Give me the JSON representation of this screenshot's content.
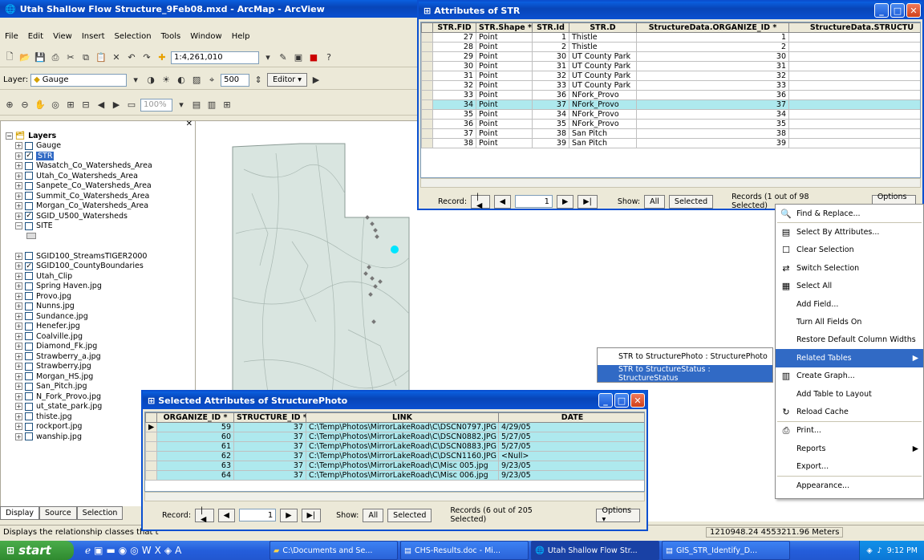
{
  "arcmap": {
    "title": "Utah Shallow Flow Structure_9Feb08.mxd - ArcMap - ArcView",
    "menu": [
      "File",
      "Edit",
      "View",
      "Insert",
      "Selection",
      "Tools",
      "Window",
      "Help"
    ],
    "scale": "1:4,261,010",
    "layer_label": "Layer:",
    "layer_value": "Gauge",
    "snap_value": "500",
    "editor_label": "Editor ▾",
    "zoom_value": "100%",
    "toc_title": "Layers",
    "toc_tabs": [
      "Display",
      "Source",
      "Selection"
    ],
    "status_left": "Displays the relationship classes that t",
    "status_coords": "1210948.24  4553211.96 Meters"
  },
  "toc": [
    {
      "label": "Gauge",
      "checked": false
    },
    {
      "label": "STR",
      "checked": true,
      "selected": true
    },
    {
      "label": "Wasatch_Co_Watersheds_Area",
      "checked": false
    },
    {
      "label": "Utah_Co_Watersheds_Area",
      "checked": false
    },
    {
      "label": "Sanpete_Co_Watersheds_Area",
      "checked": false
    },
    {
      "label": "Summit_Co_Watersheds_Area",
      "checked": false
    },
    {
      "label": "Morgan_Co_Watersheds_Area",
      "checked": false
    },
    {
      "label": "SGID_U500_Watersheds",
      "checked": true
    },
    {
      "label": "SITE",
      "checked": false,
      "expanded": true
    },
    {
      "label": "SGID100_StreamsTIGER2000",
      "checked": false
    },
    {
      "label": "SGID100_CountyBoundaries",
      "checked": true
    },
    {
      "label": "Utah_Clip",
      "checked": false
    },
    {
      "label": "Spring Haven.jpg",
      "checked": false
    },
    {
      "label": "Provo.jpg",
      "checked": false
    },
    {
      "label": "Nunns.jpg",
      "checked": false
    },
    {
      "label": "Sundance.jpg",
      "checked": false
    },
    {
      "label": "Henefer.jpg",
      "checked": false
    },
    {
      "label": "Coalville.jpg",
      "checked": false
    },
    {
      "label": "Diamond_Fk.jpg",
      "checked": false
    },
    {
      "label": "Strawberry_a.jpg",
      "checked": false
    },
    {
      "label": "Strawberry.jpg",
      "checked": false
    },
    {
      "label": "Morgan_HS.jpg",
      "checked": false
    },
    {
      "label": "San_Pitch.jpg",
      "checked": false
    },
    {
      "label": "N_Fork_Provo.jpg",
      "checked": false
    },
    {
      "label": "ut_state_park.jpg",
      "checked": false
    },
    {
      "label": "thiste.jpg",
      "checked": false
    },
    {
      "label": "rockport.jpg",
      "checked": false
    },
    {
      "label": "wanship.jpg",
      "checked": false
    }
  ],
  "str_table": {
    "title": "Attributes of STR",
    "headers": [
      "STR.FID",
      "STR.Shape *",
      "STR.Id",
      "STR.D",
      "StructureData.ORGANIZE_ID *",
      "StructureData.STRUCTU"
    ],
    "rows": [
      [
        "27",
        "Point",
        "1",
        "Thistle",
        "1",
        ""
      ],
      [
        "28",
        "Point",
        "2",
        "Thistle",
        "2",
        ""
      ],
      [
        "29",
        "Point",
        "30",
        "UT County Park",
        "30",
        ""
      ],
      [
        "30",
        "Point",
        "31",
        "UT County Park",
        "31",
        ""
      ],
      [
        "31",
        "Point",
        "32",
        "UT County Park",
        "32",
        ""
      ],
      [
        "32",
        "Point",
        "33",
        "UT County Park",
        "33",
        ""
      ],
      [
        "33",
        "Point",
        "36",
        "NFork_Provo",
        "36",
        ""
      ],
      [
        "34",
        "Point",
        "37",
        "NFork_Provo",
        "37",
        ""
      ],
      [
        "35",
        "Point",
        "34",
        "NFork_Provo",
        "34",
        ""
      ],
      [
        "36",
        "Point",
        "35",
        "NFork_Provo",
        "35",
        ""
      ],
      [
        "37",
        "Point",
        "38",
        "San Pitch",
        "38",
        ""
      ],
      [
        "38",
        "Point",
        "39",
        "San Pitch",
        "39",
        ""
      ]
    ],
    "selected_row": 7,
    "record_label": "Record:",
    "record_value": "1",
    "show_label": "Show:",
    "show_all": "All",
    "show_selected": "Selected",
    "records_text": "Records (1 out of 98 Selected)",
    "options": "Options ▾"
  },
  "photo_table": {
    "title": "Selected Attributes of StructurePhoto",
    "headers": [
      "ORGANIZE_ID *",
      "STRUCTURE_ID *",
      "LINK",
      "DATE"
    ],
    "rows": [
      [
        "59",
        "37",
        "C:\\Temp\\Photos\\MirrorLakeRoad\\C\\DSCN0797.JPG",
        "4/29/05"
      ],
      [
        "60",
        "37",
        "C:\\Temp\\Photos\\MirrorLakeRoad\\C\\DSCN0882.JPG",
        "5/27/05"
      ],
      [
        "61",
        "37",
        "C:\\Temp\\Photos\\MirrorLakeRoad\\C\\DSCN0883.JPG",
        "5/27/05"
      ],
      [
        "62",
        "37",
        "C:\\Temp\\Photos\\MirrorLakeRoad\\C\\DSCN1160.JPG",
        "<Null>"
      ],
      [
        "63",
        "37",
        "C:\\Temp\\Photos\\MirrorLakeRoad\\C\\Misc 005.jpg",
        "9/23/05"
      ],
      [
        "64",
        "37",
        "C:\\Temp\\Photos\\MirrorLakeRoad\\C\\Misc 006.jpg",
        "9/23/05"
      ]
    ],
    "record_label": "Record:",
    "record_value": "1",
    "show_label": "Show:",
    "show_all": "All",
    "show_selected": "Selected",
    "records_text": "Records (6 out of 205 Selected)",
    "options": "Options ▾"
  },
  "context_menu": [
    {
      "label": "Find & Replace...",
      "icon": "binoculars-icon",
      "glyph": "🔍"
    },
    {
      "sep": true
    },
    {
      "label": "Select By Attributes...",
      "icon": "sql-icon",
      "glyph": "▤"
    },
    {
      "label": "Clear Selection",
      "icon": "clear-selection-icon",
      "glyph": "☐"
    },
    {
      "label": "Switch Selection",
      "icon": "switch-selection-icon",
      "glyph": "⇄"
    },
    {
      "label": "Select All",
      "icon": "select-all-icon",
      "glyph": "▦"
    },
    {
      "label": "Add Field...",
      "icon": "",
      "glyph": ""
    },
    {
      "label": "Turn All Fields On",
      "icon": "",
      "glyph": ""
    },
    {
      "label": "Restore Default Column Widths",
      "icon": "",
      "glyph": ""
    },
    {
      "label": "Related Tables",
      "icon": "",
      "glyph": "",
      "highlight": true,
      "submenu": true
    },
    {
      "label": "Create Graph...",
      "icon": "graph-icon",
      "glyph": "▥"
    },
    {
      "label": "Add Table to Layout",
      "icon": "",
      "glyph": ""
    },
    {
      "label": "Reload Cache",
      "icon": "reload-icon",
      "glyph": "↻"
    },
    {
      "sep": true
    },
    {
      "label": "Print...",
      "icon": "printer-icon",
      "glyph": "⎙"
    },
    {
      "label": "Reports",
      "icon": "",
      "glyph": "",
      "submenu": true
    },
    {
      "label": "Export...",
      "icon": "",
      "glyph": ""
    },
    {
      "sep": true
    },
    {
      "label": "Appearance...",
      "icon": "",
      "glyph": ""
    }
  ],
  "submenu": [
    "STR to StructurePhoto : StructurePhoto",
    "STR to StructureStatus : StructureStatus"
  ],
  "taskbar": {
    "start": "start",
    "tasks": [
      "C:\\Documents and Se...",
      "CHS-Results.doc - Mi...",
      "Utah Shallow Flow Str...",
      "GIS_STR_Identify_D..."
    ],
    "clock": "9:12 PM"
  }
}
